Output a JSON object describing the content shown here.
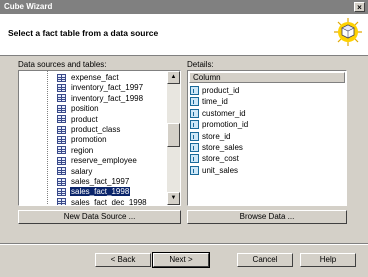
{
  "window": {
    "title": "Cube Wizard",
    "close_glyph": "×"
  },
  "header": {
    "title": "Select a fact table from a data source",
    "icon": "cube-icon"
  },
  "left_panel": {
    "label": "Data sources and tables:",
    "items": [
      {
        "label": "expense_fact",
        "selected": false
      },
      {
        "label": "inventory_fact_1997",
        "selected": false
      },
      {
        "label": "inventory_fact_1998",
        "selected": false
      },
      {
        "label": "position",
        "selected": false
      },
      {
        "label": "product",
        "selected": false
      },
      {
        "label": "product_class",
        "selected": false
      },
      {
        "label": "promotion",
        "selected": false
      },
      {
        "label": "region",
        "selected": false
      },
      {
        "label": "reserve_employee",
        "selected": false
      },
      {
        "label": "salary",
        "selected": false
      },
      {
        "label": "sales_fact_1997",
        "selected": false
      },
      {
        "label": "sales_fact_1998",
        "selected": true
      },
      {
        "label": "sales_fact_dec_1998",
        "selected": false
      }
    ],
    "scroll_up_glyph": "▲",
    "scroll_down_glyph": "▼",
    "new_data_source_button": "New Data Source ..."
  },
  "right_panel": {
    "label": "Details:",
    "column_header": "Column",
    "items": [
      "product_id",
      "time_id",
      "customer_id",
      "promotion_id",
      "store_id",
      "store_sales",
      "store_cost",
      "unit_sales"
    ],
    "browse_data_button": "Browse Data ..."
  },
  "footer": {
    "back_button": "< Back",
    "next_button": "Next >",
    "cancel_button": "Cancel",
    "help_button": "Help"
  }
}
